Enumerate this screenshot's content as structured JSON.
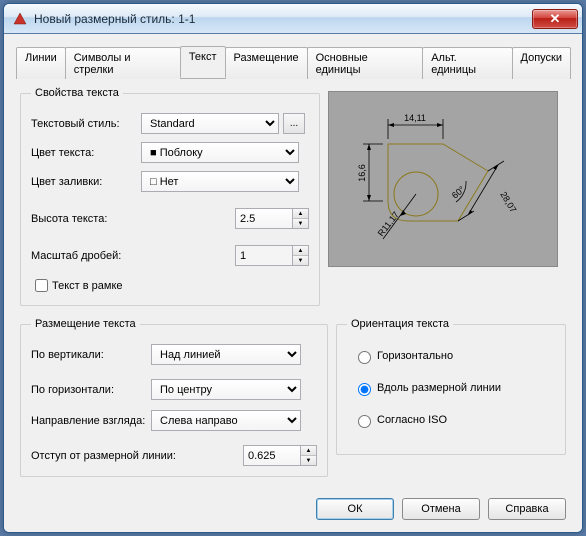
{
  "window": {
    "title": "Новый размерный стиль: 1-1"
  },
  "tabs": {
    "lines": "Линии",
    "symbols": "Символы и стрелки",
    "text": "Текст",
    "fit": "Размещение",
    "primary": "Основные единицы",
    "alt": "Альт. единицы",
    "tol": "Допуски"
  },
  "appearance": {
    "legend": "Свойства текста",
    "style_label": "Текстовый стиль:",
    "style_value": "Standard",
    "brows_btn": "...",
    "color_label": "Цвет текста:",
    "color_value": "Поблоку",
    "fill_label": "Цвет заливки:",
    "fill_value": "Нет",
    "height_label": "Высота текста:",
    "height_value": "2.5",
    "frac_label": "Масштаб дробей:",
    "frac_value": "1",
    "frame_label": "Текст в рамке"
  },
  "placement": {
    "legend": "Размещение текста",
    "vert_label": "По вертикали:",
    "vert_value": "Над линией",
    "horiz_label": "По горизонтали:",
    "horiz_value": "По центру",
    "view_label": "Направление взгляда:",
    "view_value": "Слева направо",
    "offset_label": "Отступ от размерной линии:",
    "offset_value": "0.625"
  },
  "orient": {
    "legend": "Ориентация текста",
    "horiz": "Горизонтально",
    "aligned": "Вдоль размерной линии",
    "iso": "Согласно ISO"
  },
  "preview": {
    "d1": "14,11",
    "d2": "16,6",
    "d3": "28,07",
    "angle": "60°",
    "radius": "R11,17"
  },
  "buttons": {
    "ok": "ОК",
    "cancel": "Отмена",
    "help": "Справка"
  }
}
